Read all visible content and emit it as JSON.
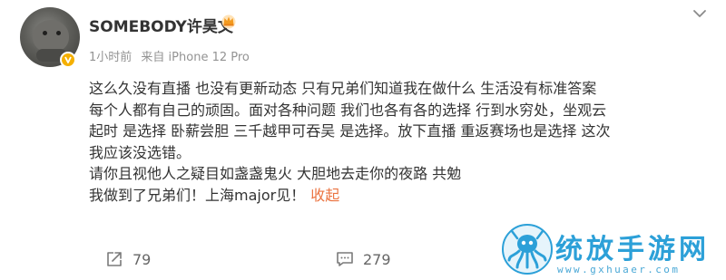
{
  "post": {
    "username": "SOMEBODY许昊文",
    "meta": {
      "time": "1小时前",
      "source": "来自 iPhone 12 Pro"
    },
    "content_lines": [
      "这么久没有直播 也没有更新动态 只有兄弟们知道我在做什么 生活没有标准答案",
      "每个人都有自己的顽固。面对各种问题 我们也各有各的选择 行到水穷处，坐观云",
      "起时 是选择 卧薪尝胆 三千越甲可吞吴 是选择。放下直播 重返赛场也是选择 这次",
      "我应该没选错。",
      "请你且视他人之疑目如盏盏鬼火 大胆地去走你的夜路 共勉",
      " 我做到了兄弟们！上海major见！"
    ],
    "collapse_label": "收起",
    "actions": {
      "repost_count": "79",
      "comment_count": "279"
    }
  },
  "watermark": {
    "title": "统放手游网",
    "url": "www.gxhuaer.com"
  },
  "icons": {
    "crown": "crown-icon",
    "verified": "verified-badge-icon",
    "more": "chevron-down-icon",
    "repost": "repost-icon",
    "comment": "comment-icon",
    "logo": "octopus-logo-icon"
  },
  "colors": {
    "text": "#333333",
    "meta": "#939393",
    "link": "#eb7340",
    "badge": "#f5b000",
    "watermark": "#2ca0d8"
  }
}
